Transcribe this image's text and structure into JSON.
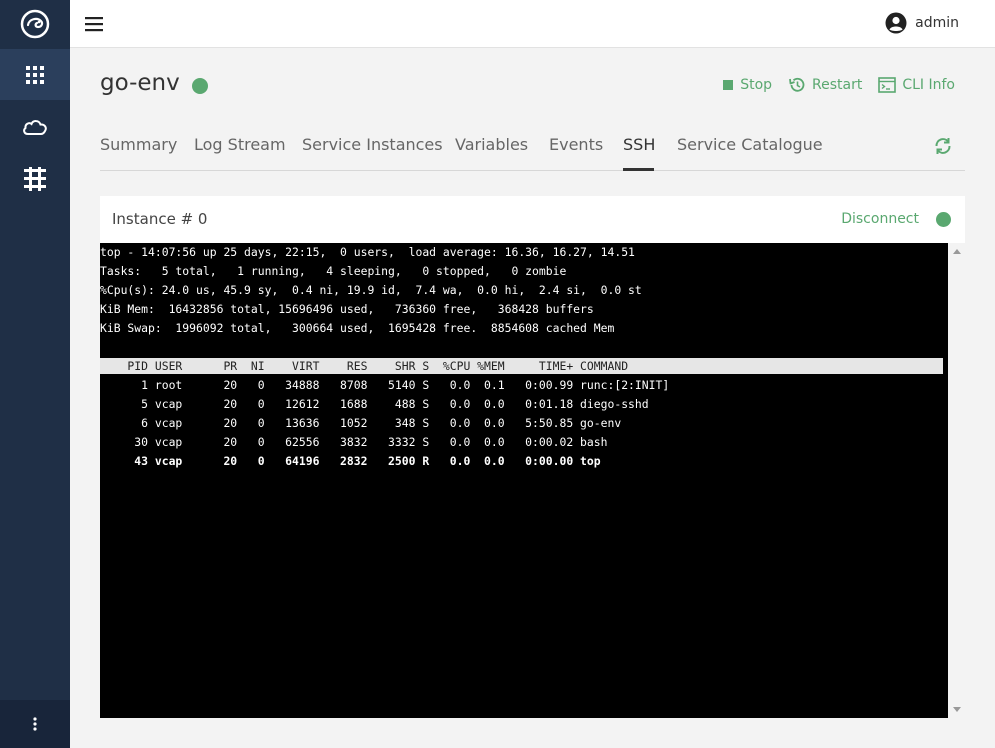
{
  "sidebar": {
    "items": [
      {
        "icon": "apps-grid-icon",
        "active": true
      },
      {
        "icon": "cloud-icon",
        "active": false
      },
      {
        "icon": "services-icon",
        "active": false
      }
    ],
    "more_icon": "more-vertical-icon"
  },
  "topbar": {
    "user": "admin"
  },
  "app": {
    "name": "go-env",
    "status_color": "#5aa870"
  },
  "actions": {
    "stop": "Stop",
    "restart": "Restart",
    "cli_info": "CLI Info"
  },
  "tabs": [
    {
      "label": "Summary"
    },
    {
      "label": "Log Stream"
    },
    {
      "label": "Service Instances"
    },
    {
      "label": "Variables"
    },
    {
      "label": "Events"
    },
    {
      "label": "SSH",
      "active": true
    },
    {
      "label": "Service Catalogue"
    }
  ],
  "panel": {
    "title": "Instance # 0",
    "disconnect": "Disconnect"
  },
  "terminal": {
    "summary": [
      "top - 14:07:56 up 25 days, 22:15,  0 users,  load average: 16.36, 16.27, 14.51",
      "Tasks:   5 total,   1 running,   4 sleeping,   0 stopped,   0 zombie",
      "%Cpu(s): 24.0 us, 45.9 sy,  0.4 ni, 19.9 id,  7.4 wa,  0.0 hi,  2.4 si,  0.0 st",
      "KiB Mem:  16432856 total, 15696496 used,   736360 free,   368428 buffers",
      "KiB Swap:  1996092 total,   300664 used,  1695428 free.  8854608 cached Mem"
    ],
    "header": "    PID USER      PR  NI    VIRT    RES    SHR S  %CPU %MEM     TIME+ COMMAND",
    "processes": [
      "      1 root      20   0   34888   8708   5140 S   0.0  0.1   0:00.99 runc:[2:INIT]",
      "      5 vcap      20   0   12612   1688    488 S   0.0  0.0   0:01.18 diego-sshd",
      "      6 vcap      20   0   13636   1052    348 S   0.0  0.0   5:50.85 go-env",
      "     30 vcap      20   0   62556   3832   3332 S   0.0  0.0   0:00.02 bash",
      "     43 vcap      20   0   64196   2832   2500 R   0.0  0.0   0:00.00 top"
    ]
  }
}
